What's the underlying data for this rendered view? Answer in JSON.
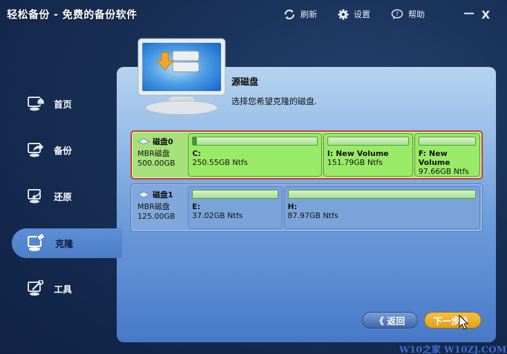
{
  "app": {
    "title": "轻松备份 - 免费的备份软件",
    "actions": [
      {
        "label": "刷新",
        "icon": "refresh-icon"
      },
      {
        "label": "设置",
        "icon": "gear-icon"
      },
      {
        "label": "帮助",
        "icon": "help-icon"
      }
    ],
    "minimize": "—",
    "close": "X"
  },
  "sidebar": {
    "items": [
      {
        "label": "首页",
        "icon": "home-monitor-icon",
        "active": false
      },
      {
        "label": "备份",
        "icon": "backup-monitor-icon",
        "active": false
      },
      {
        "label": "还原",
        "icon": "restore-monitor-icon",
        "active": false
      },
      {
        "label": "克隆",
        "icon": "clone-monitor-icon",
        "active": true
      },
      {
        "label": "工具",
        "icon": "tools-monitor-icon",
        "active": false
      }
    ]
  },
  "content": {
    "title": "源磁盘",
    "description": "选择您希望克隆的磁盘.",
    "disks": [
      {
        "name": "磁盘0",
        "type": "MBR磁盘",
        "size": "500.00GB",
        "selected": true,
        "partitions": [
          {
            "name": "C:",
            "size": "250.55GB Ntfs",
            "used_fraction": 0.03
          },
          {
            "name": "I: New Volume",
            "size": "151.79GB Ntfs",
            "used_fraction": 0
          },
          {
            "name": "F: New Volume",
            "size": "97.66GB Ntfs",
            "used_fraction": 0
          }
        ]
      },
      {
        "name": "磁盘1",
        "type": "MBR磁盘",
        "size": "125.00GB",
        "selected": false,
        "partitions": [
          {
            "name": "E:",
            "size": "37.02GB Ntfs",
            "used_fraction": 0
          },
          {
            "name": "H:",
            "size": "87.97GB Ntfs",
            "used_fraction": 0
          }
        ]
      }
    ]
  },
  "buttons": {
    "back": "《 返回",
    "next": "下一步 》"
  },
  "watermark": "W10之家 W10ZJ.COM"
}
